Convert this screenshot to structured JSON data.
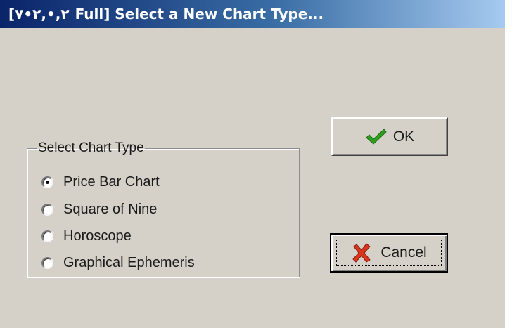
{
  "window": {
    "title_prefix": "[٢,•,٢•٧",
    "title_main": "Full] Select a New Chart Type..."
  },
  "chart_type_group": {
    "legend": "Select Chart Type",
    "selected": "Price Bar Chart",
    "options": [
      {
        "label": "Price Bar Chart",
        "checked": true
      },
      {
        "label": "Square of Nine",
        "checked": false
      },
      {
        "label": "Horoscope",
        "checked": false
      },
      {
        "label": "Graphical Ephemeris",
        "checked": false
      }
    ]
  },
  "buttons": {
    "ok": {
      "label": "OK",
      "icon": "checkmark-icon",
      "icon_color": "#2e9e1f"
    },
    "cancel": {
      "label": "Cancel",
      "icon": "x-icon",
      "icon_color": "#d8361f",
      "focused": true
    }
  },
  "colors": {
    "title_bar_start": "#0a246a",
    "title_bar_end": "#a6caf0",
    "dialog_face": "#d5d1c9"
  }
}
